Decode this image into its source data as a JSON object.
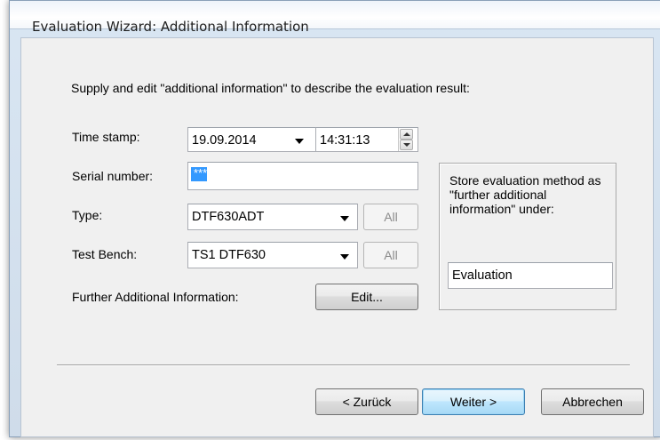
{
  "window": {
    "title": "Evaluation Wizard: Additional Information"
  },
  "intro_text": "Supply and edit \"additional information\" to describe the evaluation result:",
  "timestamp": {
    "label": "Time stamp:",
    "date_value": "19.09.2014",
    "time_value": "14:31:13"
  },
  "serial_number": {
    "label": "Serial number:",
    "value": "***"
  },
  "type": {
    "label": "Type:",
    "value": "DTF630ADT",
    "all_button": "All"
  },
  "test_bench": {
    "label": "Test Bench:",
    "value": "TS1 DTF630",
    "all_button": "All"
  },
  "further_info": {
    "label": "Further Additional Information:",
    "edit_button": "Edit..."
  },
  "store_group": {
    "text": "Store evaluation method as \"further additional information\" under:",
    "value": "Evaluation"
  },
  "footer": {
    "back_button": "< Zurück",
    "next_button": "Weiter >",
    "cancel_button": "Abbrechen"
  },
  "icons": [
    "dropdown-arrow-icon",
    "spin-up-icon",
    "spin-down-icon"
  ],
  "colors": {
    "frame": "#cfdcea",
    "client": "#f0f0f0",
    "selection": "#3399ff",
    "default_button_border": "#3c7fb1"
  }
}
